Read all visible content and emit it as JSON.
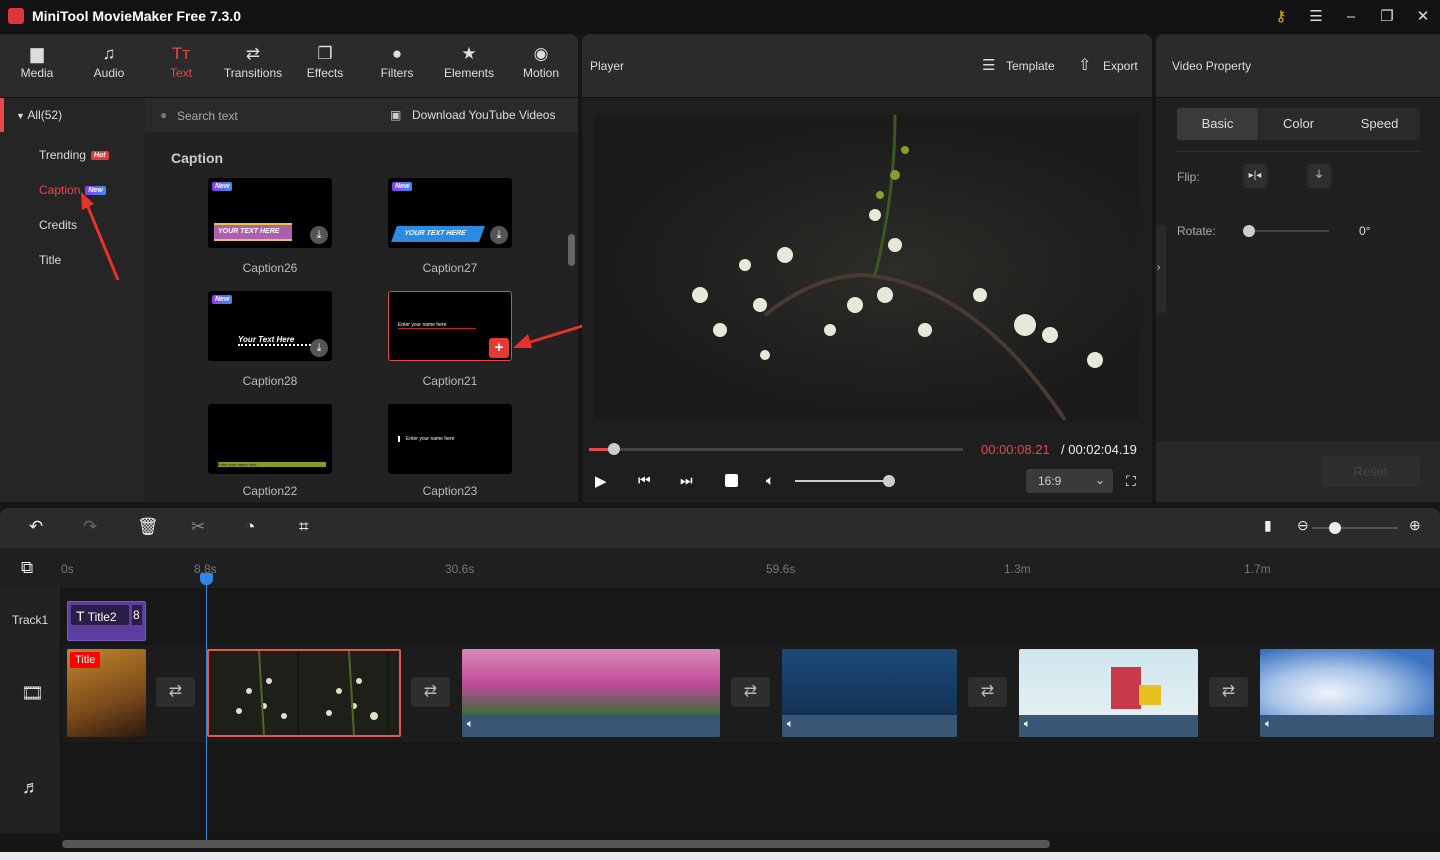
{
  "app": {
    "title": "MiniTool MovieMaker Free 7.3.0"
  },
  "toolbar": {
    "items": [
      {
        "label": "Media",
        "icon": "folder-icon"
      },
      {
        "label": "Audio",
        "icon": "music-icon"
      },
      {
        "label": "Text",
        "icon": "text-icon",
        "active": true
      },
      {
        "label": "Transitions",
        "icon": "swap-icon"
      },
      {
        "label": "Effects",
        "icon": "effects-icon"
      },
      {
        "label": "Filters",
        "icon": "filters-icon"
      },
      {
        "label": "Elements",
        "icon": "elements-icon"
      },
      {
        "label": "Motion",
        "icon": "motion-icon"
      }
    ]
  },
  "categories": {
    "all": "All(52)",
    "items": [
      {
        "label": "Trending",
        "badge": "Hot",
        "badge_color": "#e03a3a"
      },
      {
        "label": "Caption",
        "badge": "New",
        "badge_color": "#5a5af0",
        "active": true
      },
      {
        "label": "Credits"
      },
      {
        "label": "Title"
      }
    ]
  },
  "search": {
    "placeholder": "Search text",
    "download": "Download YouTube Videos"
  },
  "grid": {
    "section": "Caption",
    "items": [
      {
        "label": "Caption26",
        "new": "New",
        "preview": "YOUR TEXT HERE"
      },
      {
        "label": "Caption27",
        "new": "New",
        "preview": "YOUR TEXT HERE"
      },
      {
        "label": "Caption28",
        "new": "New",
        "preview": "Your Text Here"
      },
      {
        "label": "Caption21",
        "preview": "Enter your name here"
      },
      {
        "label": "Caption22",
        "preview": "Enter your name here"
      },
      {
        "label": "Caption23",
        "preview": "Enter your name here"
      }
    ]
  },
  "player": {
    "title": "Player",
    "template": "Template",
    "export": "Export",
    "current_time": "00:00:08.21",
    "total_time": "/ 00:02:04.19",
    "progress": 0.066,
    "volume": 0.8,
    "aspect": "16:9"
  },
  "property": {
    "title": "Video Property",
    "tabs": [
      "Basic",
      "Color",
      "Speed"
    ],
    "flip_label": "Flip:",
    "rotate_label": "Rotate:",
    "rotate_value": "0°",
    "rotate_fraction": 0,
    "reset": "Reset"
  },
  "timeline": {
    "ruler": [
      "0s",
      "8.8s",
      "30.6s",
      "59.6s",
      "1.3m",
      "1.7m"
    ],
    "track1": "Track1",
    "text_clip": "Title2",
    "text_clip_extra": "8",
    "title_clip_tag": "Title"
  },
  "colors": {
    "accent": "#e5474a",
    "playhead": "#2f86e6",
    "text_clip": "#5b3ea0"
  }
}
